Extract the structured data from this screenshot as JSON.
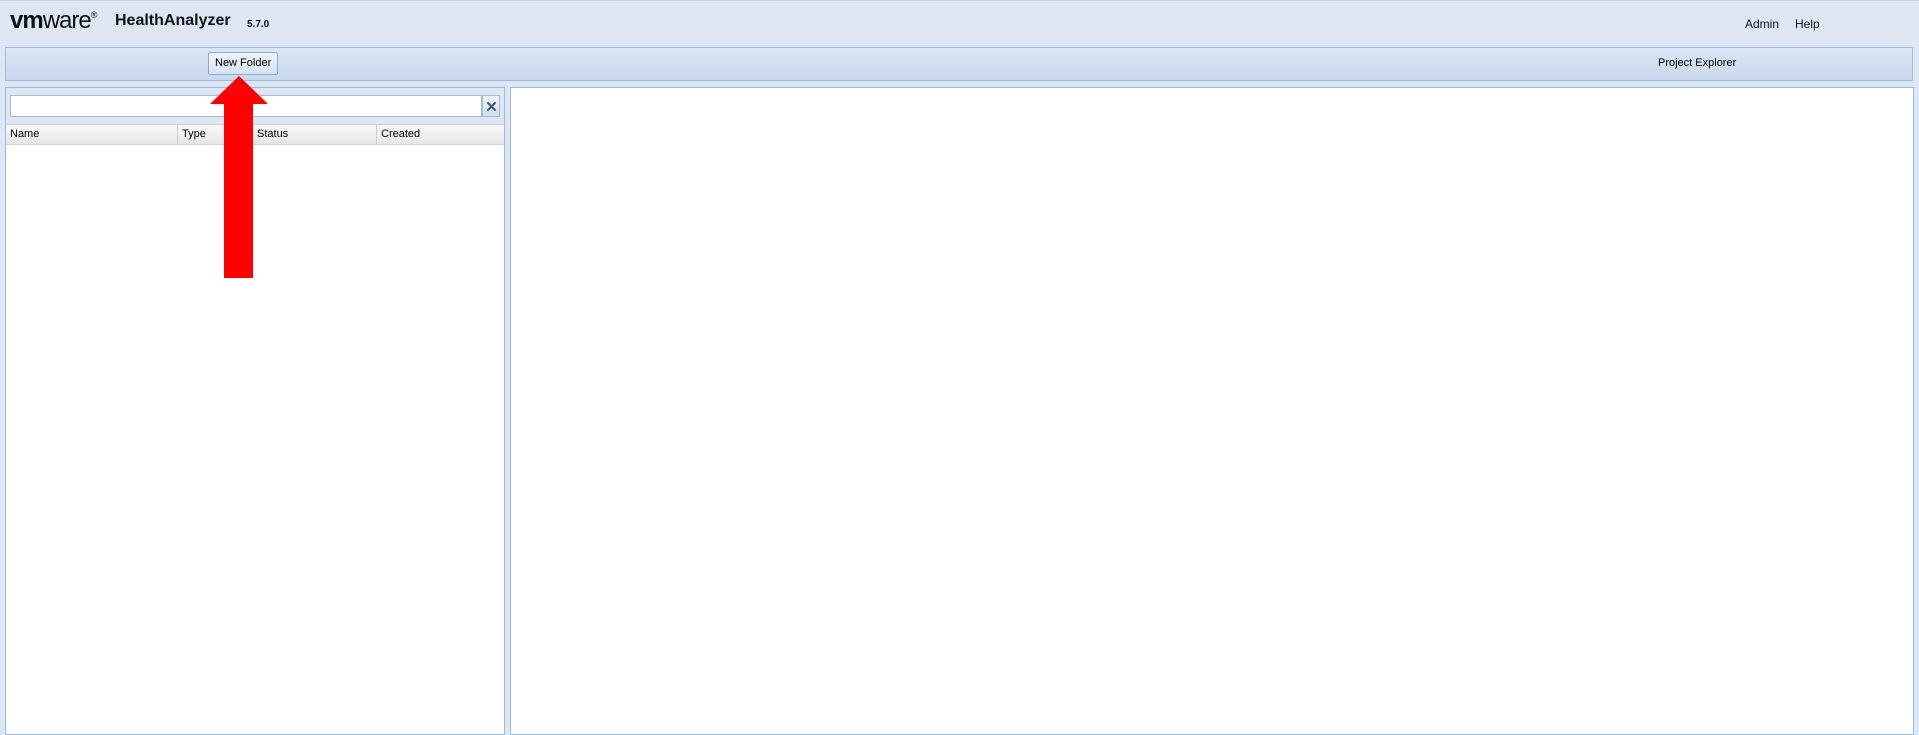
{
  "header": {
    "logo": {
      "vm": "vm",
      "ware": "ware",
      "reg": "®"
    },
    "product_name": "HealthAnalyzer",
    "version": "5.7.0",
    "nav": {
      "admin": "Admin",
      "help": "Help"
    }
  },
  "toolbar": {
    "new_folder_label": "New Folder",
    "tab_label": "Project Explorer"
  },
  "left_panel": {
    "search": {
      "value": "",
      "placeholder": ""
    },
    "clear_icon": "close-icon",
    "columns": [
      "Name",
      "Type",
      "Status",
      "Created"
    ],
    "rows": []
  },
  "annotation": {
    "arrow_color": "#ff0000",
    "arrow_icon": "up-arrow-icon"
  },
  "colors": {
    "background": "#dde7f4",
    "border": "#99bbe8"
  }
}
